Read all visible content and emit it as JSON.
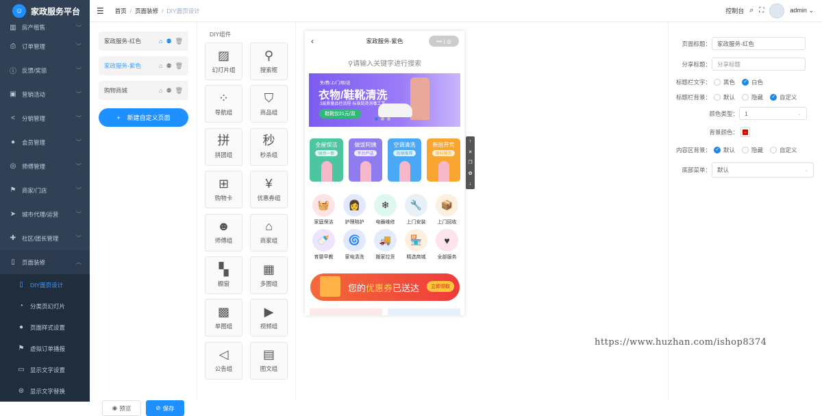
{
  "app": {
    "title": "家政服务平台"
  },
  "sidebar": {
    "items": [
      {
        "label": "房产租售",
        "icon": "building-icon"
      },
      {
        "label": "订单管理",
        "icon": "printer-icon"
      },
      {
        "label": "反馈/奖惩",
        "icon": "info-circle-icon"
      },
      {
        "label": "营销活动",
        "icon": "gift-icon"
      },
      {
        "label": "分销管理",
        "icon": "share-icon"
      },
      {
        "label": "会员管理",
        "icon": "user-icon"
      },
      {
        "label": "师傅管理",
        "icon": "lifebuoy-icon"
      },
      {
        "label": "商家/门店",
        "icon": "flag-icon"
      },
      {
        "label": "城市代理/运营",
        "icon": "location-arrow-icon"
      },
      {
        "label": "社区/团长管理",
        "icon": "community-icon"
      },
      {
        "label": "页面装修",
        "icon": "mouse-icon"
      }
    ],
    "sub": [
      {
        "label": "DIY面页设计"
      },
      {
        "label": "分类页幻灯片"
      },
      {
        "label": "页面样式设置"
      },
      {
        "label": "虚拟订单播报"
      },
      {
        "label": "显示文字设置"
      },
      {
        "label": "显示文字替换"
      }
    ]
  },
  "topbar": {
    "breadcrumb": [
      "首页",
      "页面装修",
      "DIY面页设计"
    ],
    "console": "控制台",
    "user": "admin"
  },
  "pages": {
    "items": [
      {
        "name": "家政服务-红色"
      },
      {
        "name": "家政服务-紫色"
      },
      {
        "name": "购物商城"
      }
    ],
    "new_label": "新建自定义页面",
    "preview": "预览",
    "save": "保存"
  },
  "components": {
    "title": "DIY组件",
    "items": [
      "幻灯片组",
      "搜索框",
      "导航组",
      "商品组",
      "拼团组",
      "秒杀组",
      "购物卡",
      "优惠券组",
      "师傅组",
      "商家组",
      "橱窗",
      "多图组",
      "单图组",
      "视频组",
      "公告组",
      "图文组"
    ]
  },
  "phone": {
    "title": "家政服务-紫色",
    "search": "请输入关键字进行搜索",
    "banner": {
      "top": "免/费/上/门/取/送",
      "title": "衣物/鞋靴清洗",
      "sub": "3层质量品控流程·标准熨烫消毒工艺",
      "tag": "鞋靴仅21元/双"
    },
    "cards": [
      {
        "t": "全屋保洁",
        "s": "焕然一新",
        "c": "#4cc5a0"
      },
      {
        "t": "做饭阿姨",
        "s": "平台严选",
        "c": "#8f7cf0"
      },
      {
        "t": "空调清洗",
        "s": "热销推荐",
        "c": "#4aa8f5"
      },
      {
        "t": "新居开荒",
        "s": "随叫随到",
        "c": "#f8a531"
      }
    ],
    "nav": [
      {
        "l": "家庭保洁",
        "c": "#fde3e3"
      },
      {
        "l": "护理陪护",
        "c": "#e3e9fd"
      },
      {
        "l": "电器维修",
        "c": "#dff7f1"
      },
      {
        "l": "上门安装",
        "c": "#e8f1f8"
      },
      {
        "l": "上门回收",
        "c": "#fdf0df"
      },
      {
        "l": "育婴早教",
        "c": "#efe4fd"
      },
      {
        "l": "家电清洗",
        "c": "#e3e9fd"
      },
      {
        "l": "搬家拉货",
        "c": "#e3ecfd"
      },
      {
        "l": "精选商城",
        "c": "#fdf0df"
      },
      {
        "l": "全部服务",
        "c": "#fde3ec"
      }
    ],
    "coupon": {
      "a": "您的",
      "b": "优惠券",
      "c": "已送达",
      "btn": "立即领取"
    }
  },
  "settings": {
    "page_title_label": "页面标题：",
    "page_title": "家政服务-红色",
    "share_label": "分享标题：",
    "share_placeholder": "分享标题",
    "bar_text_label": "标题栏文字：",
    "black": "黑色",
    "white": "白色",
    "bar_bg_label": "标题栏背景：",
    "default": "默认",
    "hidden": "隐藏",
    "custom": "自定义",
    "color_type_label": "颜色类型：",
    "color_type": "1",
    "bg_color_label": "背景颜色：",
    "bg_color": "#e00000",
    "content_bg_label": "内容区背景：",
    "bottom_menu_label": "底部菜单：",
    "bottom_menu": "默认"
  },
  "watermark": "https://www.huzhan.com/ishop8374"
}
